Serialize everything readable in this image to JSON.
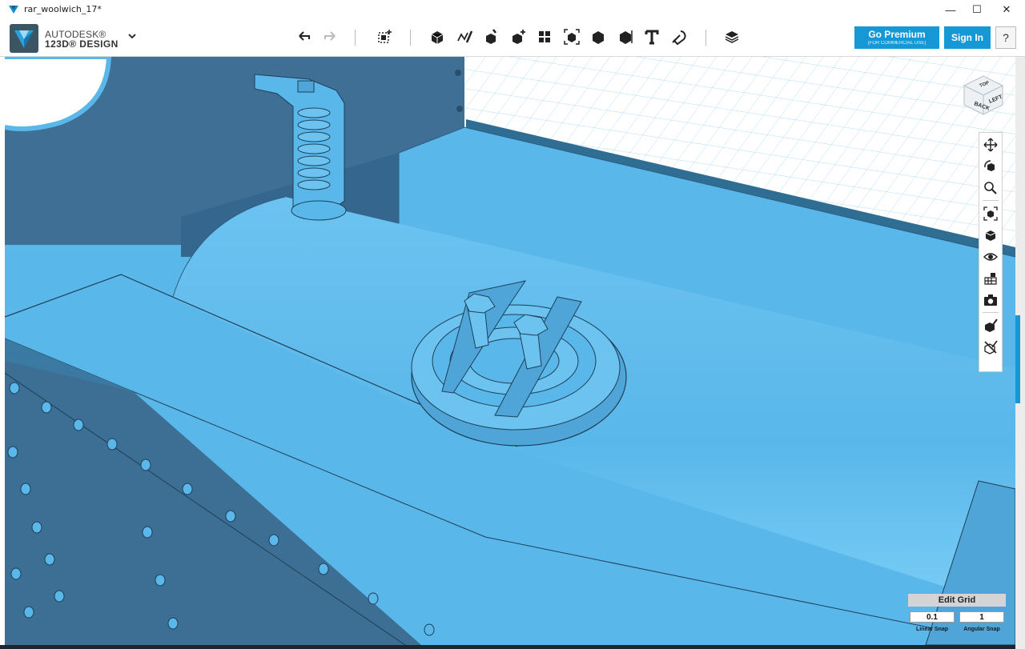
{
  "window": {
    "title": "rar_woolwich_17*",
    "controls": {
      "minimize": "—",
      "maximize": "☐",
      "close": "✕"
    }
  },
  "brand": {
    "line1": "AUTODESK®",
    "line2": "123D® DESIGN"
  },
  "toolbar": {
    "items": [
      "undo-icon",
      "redo-icon",
      "select-transform-icon",
      "primitives-icon",
      "sketch-icon",
      "construct-icon",
      "modify-icon",
      "pattern-icon",
      "group-icon",
      "combine-icon",
      "measure-icon",
      "text-icon",
      "snap-icon",
      "material-icon"
    ]
  },
  "account": {
    "premium_label": "Go Premium",
    "premium_sub": "(FOR COMMERCIAL USE)",
    "signin_label": "Sign In",
    "help_label": "?"
  },
  "viewcube": {
    "front": "BACK",
    "right": "LEFT",
    "top": "TOP"
  },
  "nav_panel": {
    "items": [
      "pan-icon",
      "orbit-icon",
      "zoom-icon",
      "fit-icon",
      "view-mode-icon",
      "visibility-icon",
      "grid-material-icon",
      "camera-icon",
      "snapshot-edit-icon",
      "snapshot-clear-icon"
    ]
  },
  "grid": {
    "edit_label": "Edit Grid",
    "linear_snap_value": "0.1",
    "angular_snap_value": "1",
    "linear_snap_label": "Linear Snap",
    "angular_snap_label": "Angular Snap"
  },
  "colors": {
    "accent": "#1697d6",
    "model": "#5ab7ea",
    "model_shadow": "#3f7fa8",
    "grid_line": "#8fd0f0",
    "background": "#ffffff"
  }
}
